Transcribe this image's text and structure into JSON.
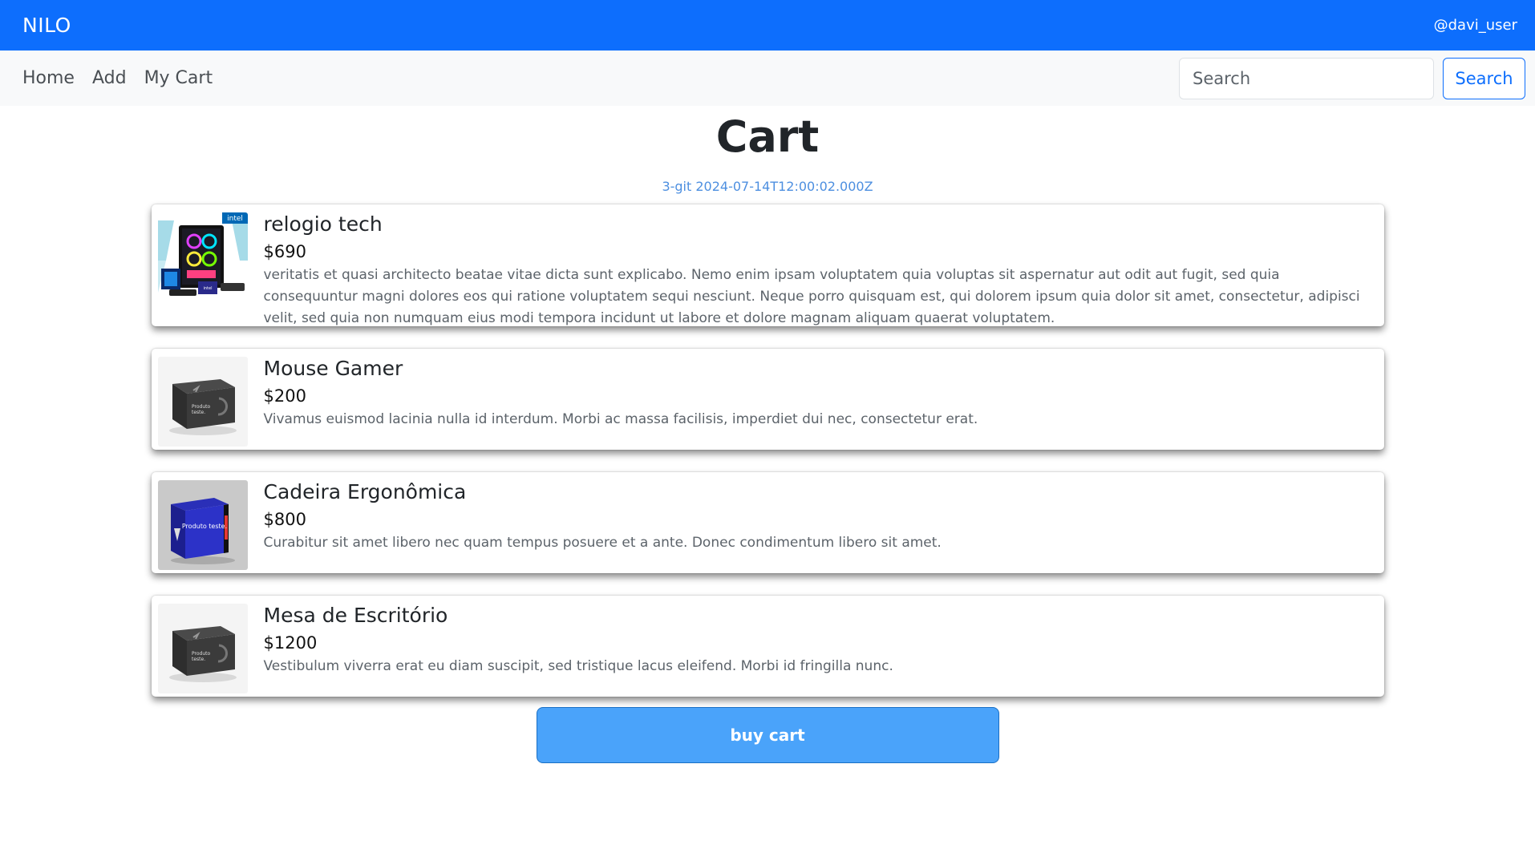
{
  "app": {
    "brand": "NILO",
    "username": "@davi_user"
  },
  "nav": {
    "links": [
      "Home",
      "Add",
      "My Cart"
    ],
    "search_placeholder": "Search",
    "search_button": "Search"
  },
  "page": {
    "title": "Cart",
    "version": "3-git 2024-07-14T12:00:02.000Z"
  },
  "cart": {
    "items": [
      {
        "name": "relogio tech",
        "price": "$690",
        "description": "veritatis et quasi architecto beatae vitae dicta sunt explicabo. Nemo enim ipsam voluptatem quia voluptas sit aspernatur aut odit aut fugit, sed quia consequuntur magni dolores eos qui ratione voluptatem sequi nesciunt. Neque porro quisquam est, qui dolorem ipsum quia dolor sit amet, consectetur, adipisci velit, sed quia non numquam eius modi tempora incidunt ut labore et dolore magnam aliquam quaerat voluptatem.",
        "image": "gaming-pc-image"
      },
      {
        "name": "Mouse Gamer",
        "price": "$200",
        "description": "Vivamus euismod lacinia nulla id interdum. Morbi ac massa facilisis, imperdiet dui nec, consectetur erat.",
        "image": "black-product-box-image"
      },
      {
        "name": "Cadeira Ergonômica",
        "price": "$800",
        "description": "Curabitur sit amet libero nec quam tempus posuere et a ante. Donec condimentum libero sit amet.",
        "image": "blue-product-box-image",
        "box_label": "Produto teste."
      },
      {
        "name": "Mesa de Escritório",
        "price": "$1200",
        "description": "Vestibulum viverra erat eu diam suscipit, sed tristique lacus eleifend. Morbi id fringilla nunc.",
        "image": "black-product-box-image"
      }
    ],
    "buy_button": "buy cart"
  },
  "colors": {
    "primary": "#0d6efd",
    "buy_button": "#4aa3fa",
    "version_text": "#4d8fe0"
  }
}
